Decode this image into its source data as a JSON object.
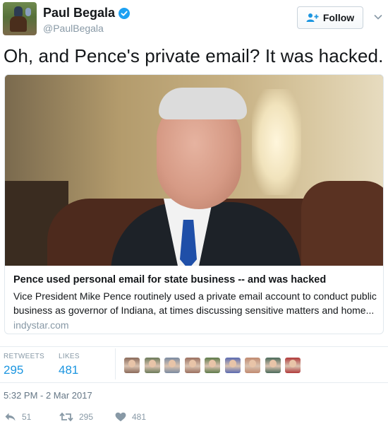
{
  "user": {
    "display_name": "Paul Begala",
    "handle": "@PaulBegala",
    "verified": true,
    "avatar_icon": "profile-photo-horse-rider"
  },
  "follow_button": {
    "label": "Follow",
    "icon": "add-user-icon"
  },
  "menu_icon": "chevron-down-icon",
  "tweet_text": "Oh, and Pence's private email? It was hacked.",
  "card": {
    "image_icon": "news-photo",
    "title": "Pence used personal email for state business -- and was hacked",
    "description": "Vice President Mike Pence routinely used a private email account to conduct public business as governor of Indiana, at times discussing sensitive matters and home...",
    "domain": "indystar.com"
  },
  "stats": {
    "retweets_label": "RETWEETS",
    "retweets_value": "295",
    "likes_label": "LIKES",
    "likes_value": "481"
  },
  "likers": [
    {
      "icon": "liker-avatar",
      "color": "#8a6a5a"
    },
    {
      "icon": "liker-avatar",
      "color": "#6b7a5a"
    },
    {
      "icon": "liker-avatar",
      "color": "#7a8aa0"
    },
    {
      "icon": "liker-avatar",
      "color": "#9a7060"
    },
    {
      "icon": "liker-avatar",
      "color": "#5e7a4a"
    },
    {
      "icon": "liker-avatar",
      "color": "#5a6ab0"
    },
    {
      "icon": "liker-avatar",
      "color": "#c08a70"
    },
    {
      "icon": "liker-avatar",
      "color": "#4a6a5a"
    },
    {
      "icon": "liker-avatar",
      "color": "#b03a3a"
    }
  ],
  "timestamp": "5:32 PM - 2 Mar 2017",
  "actions": {
    "reply_count": "51",
    "retweet_count": "295",
    "like_count": "481"
  },
  "colors": {
    "accent": "#1b95e0",
    "muted": "#8899a6",
    "verified": "#1da1f2"
  }
}
